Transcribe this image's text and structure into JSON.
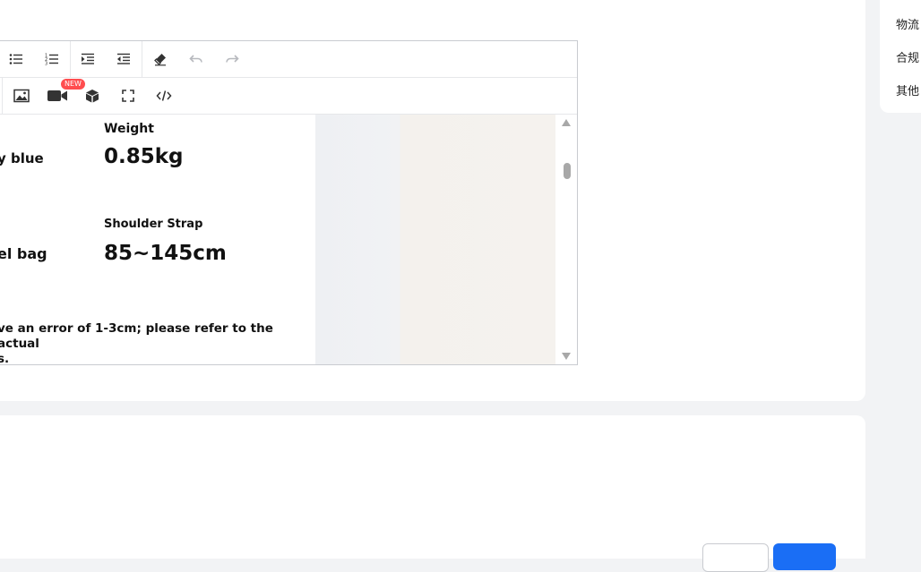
{
  "side_nav": {
    "items": [
      {
        "label": "物流"
      },
      {
        "label": "合规"
      },
      {
        "label": "其他"
      }
    ]
  },
  "toolbar": {
    "row1": [
      {
        "name": "bulleted-list-icon"
      },
      {
        "name": "numbered-list-icon"
      },
      {
        "name": "indent-increase-icon"
      },
      {
        "name": "indent-decrease-icon"
      },
      {
        "name": "eraser-icon"
      },
      {
        "name": "undo-icon"
      },
      {
        "name": "redo-icon"
      }
    ],
    "row2": [
      {
        "name": "image-icon"
      },
      {
        "name": "video-icon",
        "badge": "NEW"
      },
      {
        "name": "3d-box-icon"
      },
      {
        "name": "fullscreen-icon"
      },
      {
        "name": "code-view-icon"
      }
    ],
    "badge_color": "#ff4d4f"
  },
  "content": {
    "left_column": {
      "color_value_cut": "y blue",
      "type_value_cut": "el bag"
    },
    "weight_label": "Weight",
    "weight_value": "0.85kg",
    "strap_label": "Shoulder Strap",
    "strap_value": "85~145cm",
    "note_line1": "ve an error of 1-3cm; please refer to the actual",
    "note_line2": "s."
  },
  "colors": {
    "primary": "#1a6ef5",
    "background": "#f2f3f5",
    "card": "#ffffff"
  }
}
